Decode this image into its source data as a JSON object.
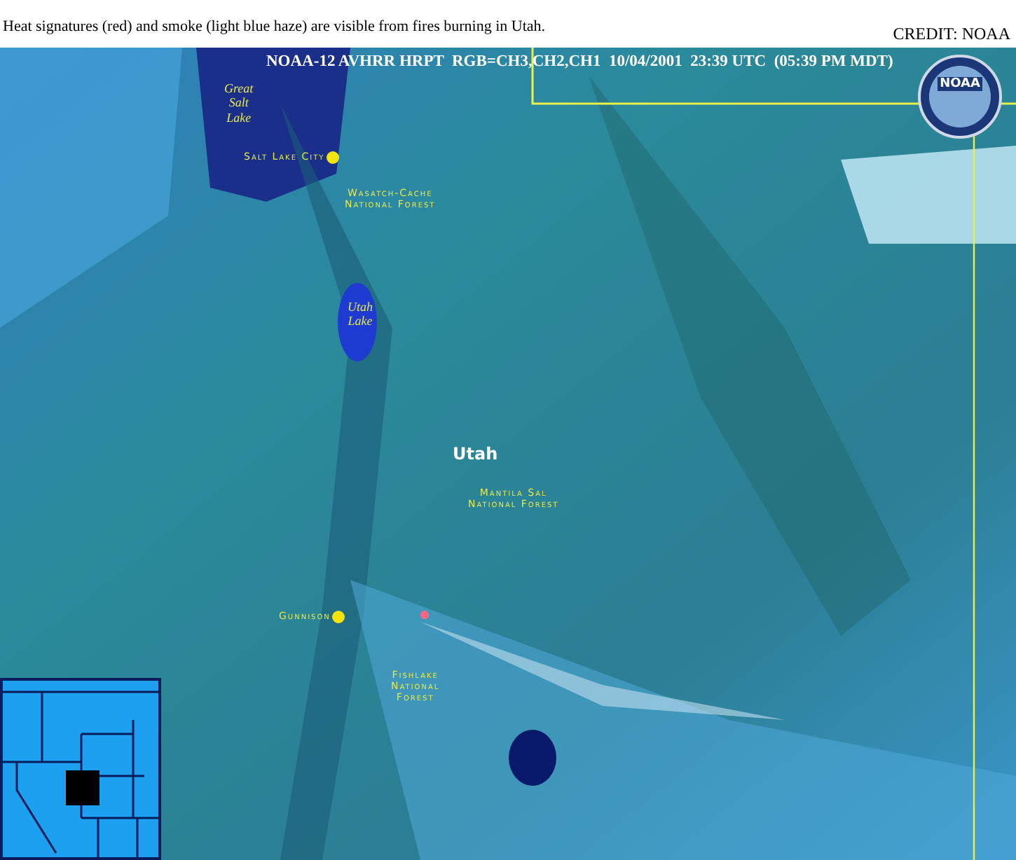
{
  "caption": "Heat signatures (red) and smoke (light blue haze) are visible from fires burning in Utah.",
  "credit": "CREDIT: NOAA",
  "image": {
    "title": "NOAA-12 AVHRR HRPT  RGB=CH3,CH2,CH1  10/04/2001  23:39 UTC  (05:39 PM MDT)",
    "logo": "NOAA",
    "labels": [
      {
        "kind": "lake",
        "text": "Great\nSalt\nLake"
      },
      {
        "kind": "city",
        "text": "Salt Lake City"
      },
      {
        "kind": "forest",
        "text": "Wasatch-Cache\nNational Forest"
      },
      {
        "kind": "lake",
        "text": "Utah\nLake"
      },
      {
        "kind": "state",
        "text": "Utah"
      },
      {
        "kind": "forest",
        "text": "Mantila Sal\nNational Forest"
      },
      {
        "kind": "city",
        "text": "Gunnison"
      },
      {
        "kind": "forest",
        "text": "Fishlake\nNational\nForest"
      }
    ]
  }
}
